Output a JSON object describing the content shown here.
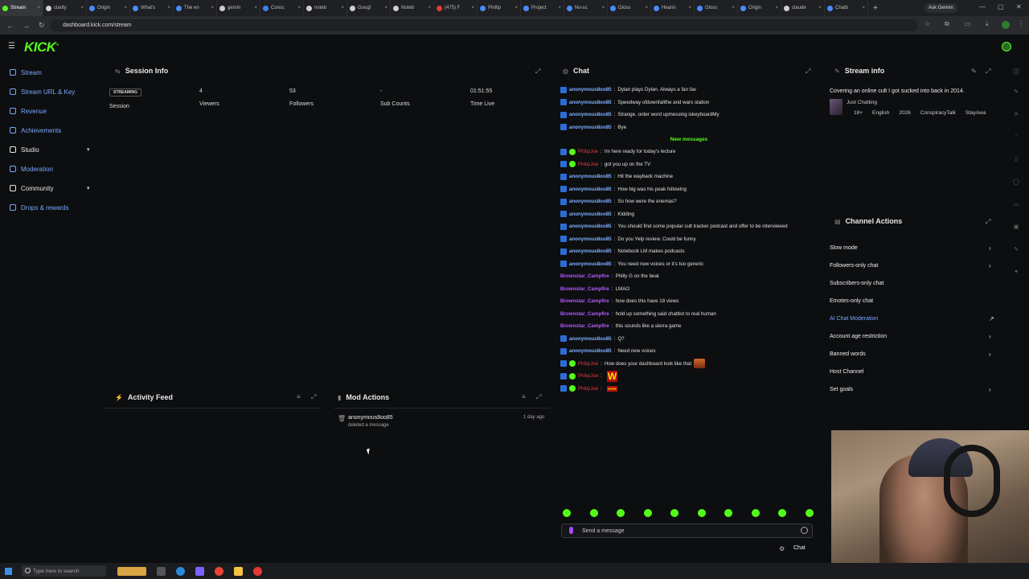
{
  "browser": {
    "tabs": [
      {
        "label": "Stream",
        "color": "#53fc18",
        "active": true
      },
      {
        "label": "clarity",
        "color": "#cfcfcf"
      },
      {
        "label": "Origin",
        "color": "#4a8cff"
      },
      {
        "label": "What's",
        "color": "#4a8cff"
      },
      {
        "label": "The en",
        "color": "#4a8cff"
      },
      {
        "label": "gemin",
        "color": "#cfcfcf"
      },
      {
        "label": "Consc",
        "color": "#3b82f6"
      },
      {
        "label": "noteb",
        "color": "#cfcfcf"
      },
      {
        "label": "Googl",
        "color": "#cfcfcf"
      },
      {
        "label": "Noteb",
        "color": "#cfcfcf"
      },
      {
        "label": "(475) F",
        "color": "#e53935"
      },
      {
        "label": "Phillip",
        "color": "#4a8cff"
      },
      {
        "label": "Project",
        "color": "#4a8cff"
      },
      {
        "label": "No-sc",
        "color": "#4a8cff"
      },
      {
        "label": "Gloss",
        "color": "#4a8cff"
      },
      {
        "label": "Hearin",
        "color": "#4a8cff"
      },
      {
        "label": "Gloss",
        "color": "#4a8cff"
      },
      {
        "label": "Origin",
        "color": "#4a8cff"
      },
      {
        "label": "claude",
        "color": "#cfcfcf"
      },
      {
        "label": "Chatb",
        "color": "#4a8cff"
      }
    ],
    "ask_gemini": "Ask Gemini",
    "url": "dashboard.kick.com/stream"
  },
  "app": {
    "logo": "KICK"
  },
  "sidebar": {
    "items": [
      {
        "label": "Stream",
        "white": false
      },
      {
        "label": "Stream URL & Key",
        "white": false
      },
      {
        "label": "Revenue",
        "white": false
      },
      {
        "label": "Achievements",
        "white": false
      },
      {
        "label": "Studio",
        "white": true,
        "chevron": true
      },
      {
        "label": "Moderation",
        "white": false
      },
      {
        "label": "Community",
        "white": true,
        "chevron": true
      },
      {
        "label": "Drops & rewards",
        "white": false
      }
    ]
  },
  "session": {
    "title": "Session Info",
    "badge": "STREAMING",
    "session_label": "Session",
    "viewers_value": "4",
    "viewers_label": "Viewers",
    "followers_value": "53",
    "followers_label": "Followers",
    "subs_value": "-",
    "subs_label": "Sub Counts",
    "time_value": "01:51:55",
    "time_label": "Time Live"
  },
  "activity": {
    "title": "Activity Feed"
  },
  "mod_actions": {
    "title": "Mod Actions",
    "user": "anonymous8oo85",
    "action": "deleted a message",
    "time": "1 day ago"
  },
  "chat": {
    "title": "Chat",
    "new_messages": "New messages",
    "messages": [
      {
        "user": "anonymous8oo85",
        "type": "anon",
        "text": "Dylan plays Dylan. Always a fan fav"
      },
      {
        "user": "anonymous8oo85",
        "type": "anon",
        "text": "Speedway ofdownfallthe and wars station"
      },
      {
        "user": "anonymous8oo85",
        "type": "anon",
        "text": "Strange. order word upmessing iskeyboardMy"
      },
      {
        "user": "anonymous8oo85",
        "type": "anon",
        "text": "Bye"
      },
      {
        "divider": true
      },
      {
        "user": "PhilipJoe",
        "type": "mod",
        "text": "Im here ready for today's lecture"
      },
      {
        "user": "PhilipJoe",
        "type": "mod",
        "text": "got you up on the TV"
      },
      {
        "user": "anonymous8oo85",
        "type": "anon",
        "text": "Hit the wayback machine"
      },
      {
        "user": "anonymous8oo85",
        "type": "anon",
        "text": "How big was his peak following"
      },
      {
        "user": "anonymous8oo85",
        "type": "anon",
        "text": "So how were the enemas?"
      },
      {
        "user": "anonymous8oo85",
        "type": "anon",
        "text": "Kidding"
      },
      {
        "user": "anonymous8oo85",
        "type": "anon",
        "text": "You should find some popular cult tracker podcast and offer to be interviewed"
      },
      {
        "user": "anonymous8oo85",
        "type": "anon",
        "text": "Do you Yelp review. Could be funny"
      },
      {
        "user": "anonymous8oo85",
        "type": "anon",
        "text": "Notebook LM makes podcasts"
      },
      {
        "user": "anonymous8oo85",
        "type": "anon",
        "text": "You need new voices or it's too generic"
      },
      {
        "user": "Brownstar_Campfire",
        "type": "brown",
        "text": "Philly G on the beat"
      },
      {
        "user": "Brownstar_Campfire",
        "type": "brown",
        "text": "LMAO"
      },
      {
        "user": "Brownstar_Campfire",
        "type": "brown",
        "text": "how does this have 18 views"
      },
      {
        "user": "Brownstar_Campfire",
        "type": "brown",
        "text": "hold up something said chatbot to real human"
      },
      {
        "user": "Brownstar_Campfire",
        "type": "brown",
        "text": "this sounds like a sierra game"
      },
      {
        "user": "anonymous8oo85",
        "type": "anon",
        "text": "Q?"
      },
      {
        "user": "anonymous8oo85",
        "type": "anon",
        "text": "Need new voices"
      },
      {
        "user": "PhilipJoe",
        "type": "mod",
        "text": "How does your dashboard look like that",
        "emote": "img"
      },
      {
        "user": "PhilipJoe",
        "type": "mod",
        "text": "",
        "emote": "W"
      },
      {
        "user": "PhilipJoe",
        "type": "mod",
        "text": "",
        "emote": "HYPE"
      }
    ],
    "input_placeholder": "Send a message",
    "send_label": "Chat"
  },
  "stream_info": {
    "title": "Stream info",
    "stream_title": "Covering an online cult I got sucked into back in 2014.",
    "category": "Just Chatting",
    "tags": [
      "18+",
      "English",
      "2026",
      "ConspiracyTalk",
      "StayAwa"
    ]
  },
  "channel_actions": {
    "title": "Channel Actions",
    "items": [
      {
        "label": "Slow mode",
        "arrow": "›"
      },
      {
        "label": "Followers-only chat",
        "arrow": "›"
      },
      {
        "label": "Subscribers-only chat",
        "arrow": ""
      },
      {
        "label": "Emotes-only chat",
        "arrow": ""
      },
      {
        "label": "AI Chat Moderation",
        "arrow": "↗",
        "blue": true
      },
      {
        "label": "Account age restriction",
        "arrow": "›"
      },
      {
        "label": "Banned words",
        "arrow": "›"
      },
      {
        "label": "Host Channel",
        "arrow": ""
      },
      {
        "label": "Set goals",
        "arrow": "›"
      }
    ]
  },
  "taskbar": {
    "search_placeholder": "Type here to search"
  }
}
